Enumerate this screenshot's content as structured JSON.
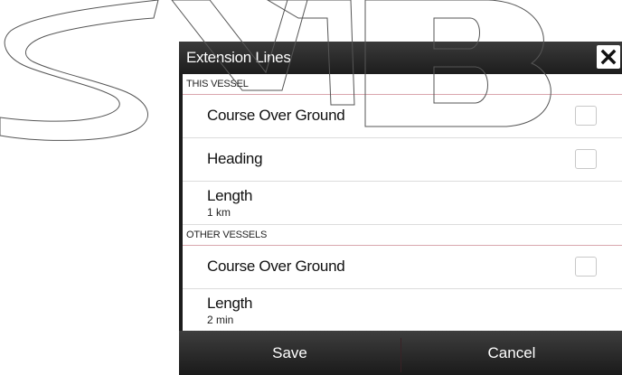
{
  "dialog": {
    "title": "Extension Lines",
    "close_icon": "close-icon"
  },
  "this_vessel": {
    "header": "THIS VESSEL",
    "course_over_ground": {
      "label": "Course Over Ground",
      "checked": false
    },
    "heading": {
      "label": "Heading",
      "checked": false
    },
    "length": {
      "label": "Length",
      "value": "1 km"
    }
  },
  "other_vessels": {
    "header": "OTHER VESSELS",
    "course_over_ground": {
      "label": "Course Over Ground",
      "checked": false
    },
    "length": {
      "label": "Length",
      "value": "2 min"
    }
  },
  "footer": {
    "save_label": "Save",
    "cancel_label": "Cancel"
  },
  "colors": {
    "dialog_frame": "#1c1c1c",
    "panel": "#ffffff",
    "section_rule": "#d9a6ad",
    "row_rule": "#dcdcdc"
  }
}
